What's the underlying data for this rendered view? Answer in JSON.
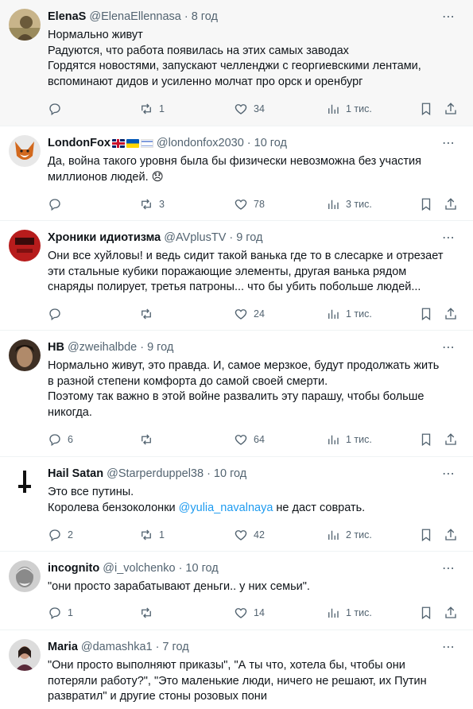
{
  "tweets": [
    {
      "name": "ElenaS",
      "handle": "@ElenaEllennasa",
      "sep": "·",
      "time": "8 год",
      "lines": [
        "Нормально живут",
        "Радуются, что работа появилась на этих самых заводах",
        "Гордятся новостями, запускают челленджи с георгиевскими лентами,",
        "вспоминают дидов и усиленно молчат про орск и оренбург"
      ],
      "replies": "",
      "retweets": "1",
      "likes": "34",
      "views": "1 тис."
    },
    {
      "name": "LondonFox",
      "flags": [
        "gb-flag",
        "ua-flag",
        "il-flag"
      ],
      "handle": "@londonfox2030",
      "sep": "·",
      "time": "10 год",
      "lines": [
        "Да, война такого уровня была бы физически невозможна без участия",
        "миллионов людей. 😞"
      ],
      "replies": "",
      "retweets": "3",
      "likes": "78",
      "views": "3 тис."
    },
    {
      "name": "Хроники идиотизма",
      "handle": "@AVplusTV",
      "sep": "·",
      "time": "9 год",
      "lines": [
        "Они все хуйловы! и ведь сидит такой ванька где то в слесарке и отрезает",
        "эти стальные кубики поражающие элементы, другая ванька  рядом",
        "снаряды полирует, третья патроны... что бы убить побольше людей..."
      ],
      "replies": "",
      "retweets": "",
      "likes": "24",
      "views": "1 тис."
    },
    {
      "name": "HB",
      "handle": "@zweihalbde",
      "sep": "·",
      "time": "9 год",
      "lines": [
        "Нормально живут, это правда. И, самое мерзкое, будут продолжать жить",
        "в разной степени комфорта до самой своей смерти.",
        "Поэтому так важно в этой войне развалить эту парашу, чтобы больше",
        "никогда."
      ],
      "replies": "6",
      "retweets": "",
      "likes": "64",
      "views": "1 тис."
    },
    {
      "name": "Hail Satan",
      "handle": "@Starperduppel38",
      "sep": "·",
      "time": "10 год",
      "lines": [
        "Это все путины.",
        "Королева бензоколонки "
      ],
      "mention": "@yulia_navalnaya",
      "after_mention": " не даст соврать.",
      "replies": "2",
      "retweets": "1",
      "likes": "42",
      "views": "2 тис."
    },
    {
      "name": "incognito",
      "handle": "@i_volchenko",
      "sep": "·",
      "time": "10 год",
      "lines": [
        "\"они просто зарабатывают деньги.. у них семьи\"."
      ],
      "replies": "1",
      "retweets": "",
      "likes": "14",
      "views": "1 тис."
    },
    {
      "name": "Maria",
      "handle": "@damashka1",
      "sep": "·",
      "time": "7 год",
      "lines": [
        "\"Они просто выполняют приказы\", \"А ты что, хотела бы, чтобы они",
        "потеряли работу?\", \"Это маленькие люди, ничего не решают, их Путин",
        "развратил\" и другие стоны розовых пони"
      ]
    }
  ],
  "colors": {
    "accent": "#1d9bf0",
    "text": "#0f1419",
    "muted": "#536471",
    "divider": "#eff3f4"
  },
  "icons": {
    "more": "⋯"
  }
}
